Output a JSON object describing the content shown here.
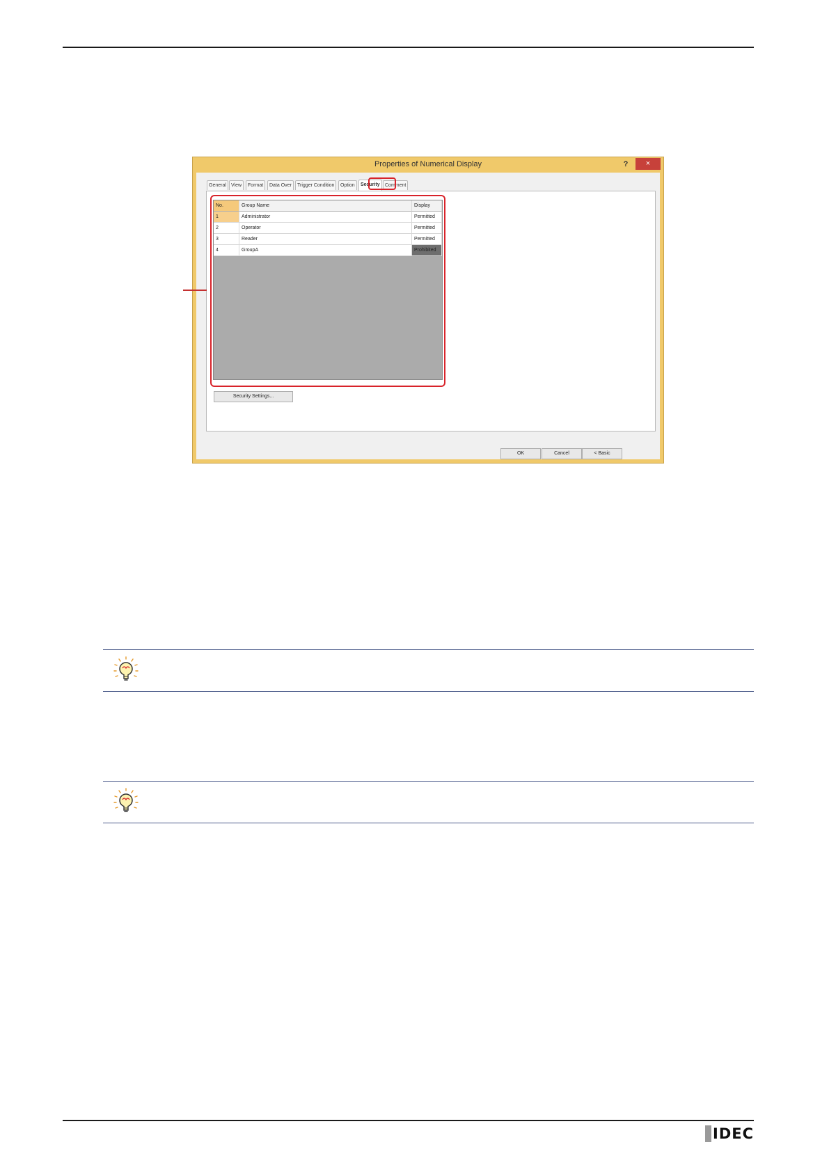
{
  "dialog": {
    "title": "Properties of Numerical Display",
    "help": "?",
    "close": "×",
    "tabs": [
      "General",
      "View",
      "Format",
      "Data Over",
      "Trigger Condition",
      "Option",
      "Security",
      "Comment"
    ],
    "active_tab": "Security",
    "grid": {
      "headers": {
        "no": "No.",
        "name": "Group Name",
        "display": "Display"
      },
      "rows": [
        {
          "no": "1",
          "name": "Administrator",
          "display": "Permitted"
        },
        {
          "no": "2",
          "name": "Operator",
          "display": "Permitted"
        },
        {
          "no": "3",
          "name": "Reader",
          "display": "Permitted"
        },
        {
          "no": "4",
          "name": "GroupA",
          "display": "Prohibited"
        }
      ]
    },
    "security_settings_button": "Security Settings...",
    "buttons": {
      "ok": "OK",
      "cancel": "Cancel",
      "basic": "< Basic"
    },
    "highlight_color": "#d8232a"
  },
  "logo": {
    "text": "IDEC"
  }
}
